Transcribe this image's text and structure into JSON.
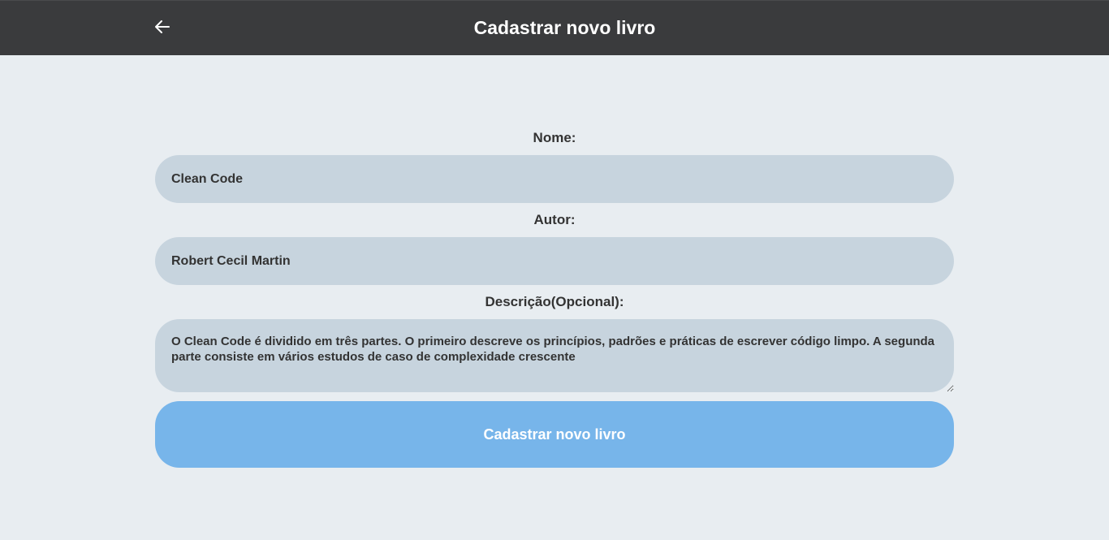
{
  "header": {
    "back_icon": "arrow-left-icon",
    "title": "Cadastrar novo livro"
  },
  "form": {
    "name": {
      "label": "Nome:",
      "value": "Clean Code"
    },
    "author": {
      "label": "Autor:",
      "value": "Robert Cecil Martin"
    },
    "description": {
      "label": "Descrição(Opcional):",
      "value": "O Clean Code é dividido em três partes. O primeiro descreve os princípios, padrões e práticas de escrever código limpo. A segunda parte consiste em vários estudos de caso de complexidade crescente"
    },
    "submit_label": "Cadastrar novo livro"
  },
  "colors": {
    "header_bg": "#3a3b3d",
    "page_bg": "#e8edf1",
    "input_bg": "#c7d4de",
    "button_bg": "#77b5ea"
  }
}
